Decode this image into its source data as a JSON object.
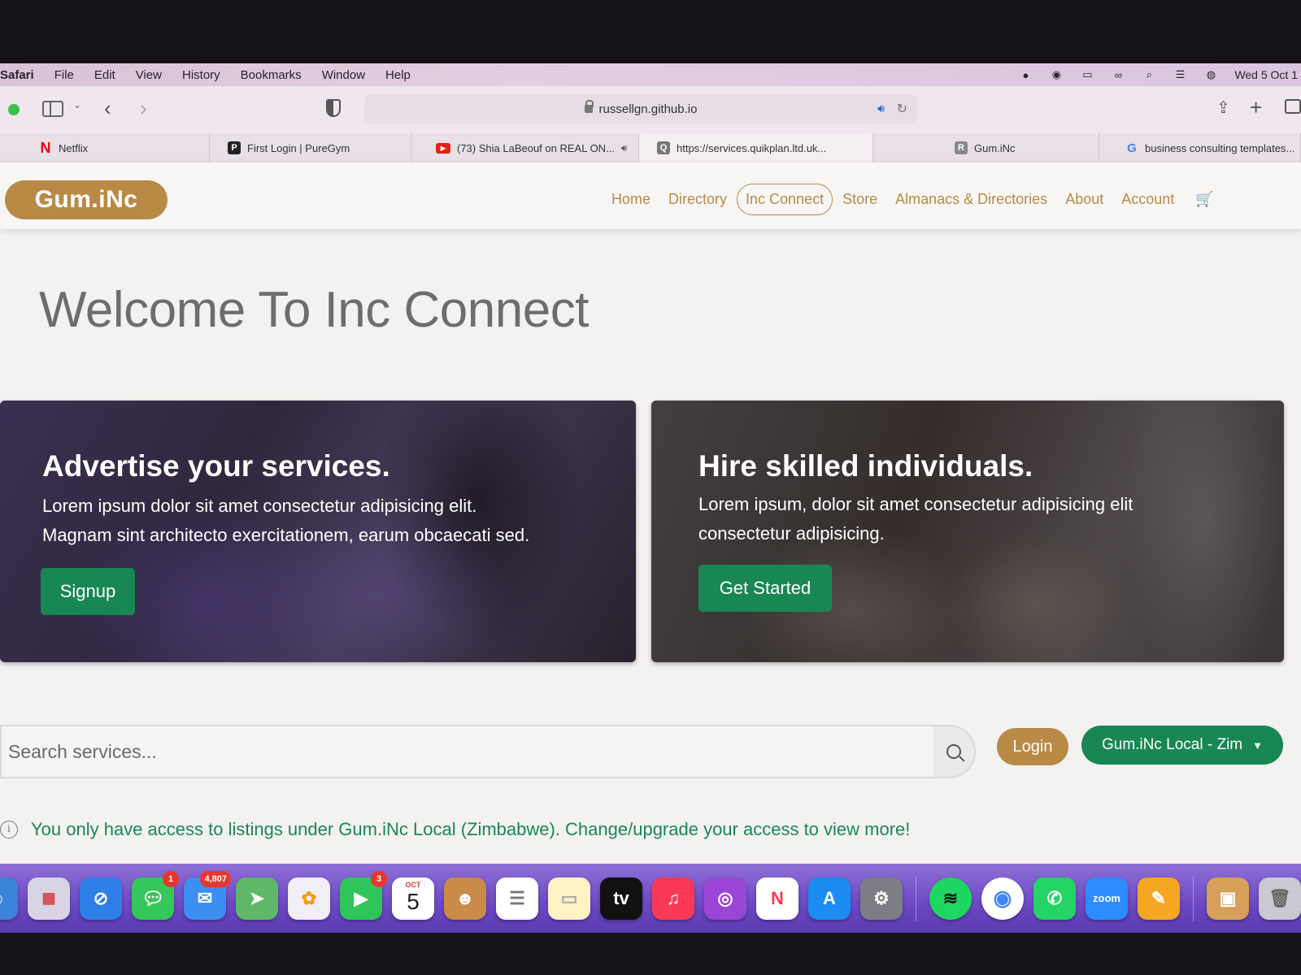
{
  "menubar": {
    "app": "Safari",
    "items": [
      "File",
      "Edit",
      "View",
      "History",
      "Bookmarks",
      "Window",
      "Help"
    ],
    "clock": "Wed 5 Oct 1"
  },
  "browser": {
    "url": "russellgn.github.io",
    "tabs": [
      {
        "label": "Netflix",
        "favicon": "N"
      },
      {
        "label": "First Login | PureGym",
        "favicon": "P"
      },
      {
        "label": "(73) Shia LaBeouf on REAL ON...",
        "favicon": "▶"
      },
      {
        "label": "https://services.quikplan.ltd.uk...",
        "favicon": "Q"
      },
      {
        "label": "Gum.iNc",
        "favicon": "R"
      },
      {
        "label": "business consulting templates...",
        "favicon": "G"
      }
    ]
  },
  "site": {
    "logo": "Gum.iNc",
    "nav": [
      "Home",
      "Directory",
      "Inc Connect",
      "Store",
      "Almanacs & Directories",
      "About",
      "Account"
    ],
    "active_nav": "Inc Connect",
    "cart_icon": "🛒",
    "welcome": "Welcome To Inc Connect",
    "card_left": {
      "title": "Advertise your services.",
      "text_line1": "Lorem ipsum dolor sit amet consectetur adipisicing elit.",
      "text_line2": "Magnam sint architecto exercitationem, earum obcaecati sed.",
      "button": "Signup"
    },
    "card_right": {
      "title": "Hire skilled individuals.",
      "text_line1": "Lorem ipsum, dolor sit amet consectetur adipisicing elit",
      "text_line2": "consectetur adipisicing.",
      "button": "Get Started"
    },
    "search": {
      "placeholder": "Search services..."
    },
    "login": "Login",
    "region": "Gum.iNc Local - Zim",
    "notice": "You only have access to listings under Gum.iNc Local (Zimbabwe). Change/upgrade your access to view more!"
  },
  "dock": {
    "badges": {
      "messages": "1",
      "mail": "4,807",
      "facetime": "3"
    },
    "calendar_month": "OCT",
    "calendar_day": "5",
    "tv_label": "tv",
    "zoom_label": "zoom"
  },
  "colors": {
    "brand": "#b98a46",
    "green": "#198754"
  }
}
